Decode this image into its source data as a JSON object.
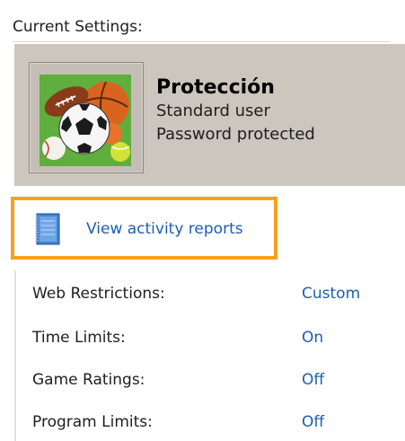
{
  "section": {
    "title": "Current Settings:"
  },
  "user": {
    "name": "Protección",
    "account_type": "Standard user",
    "password_status": "Password protected",
    "avatar_icon": "sports-balls-icon"
  },
  "reports": {
    "link_label": "View activity reports",
    "icon": "notebook-icon",
    "highlight_color": "#f6a01e"
  },
  "settings": [
    {
      "label": "Web Restrictions:",
      "value": "Custom"
    },
    {
      "label": "Time Limits:",
      "value": "On"
    },
    {
      "label": "Game Ratings:",
      "value": "Off"
    },
    {
      "label": "Program Limits:",
      "value": "Off"
    }
  ],
  "colors": {
    "link": "#1a5fb4",
    "panel": "#ccc6be",
    "avatar_background": "#5fae3e"
  }
}
